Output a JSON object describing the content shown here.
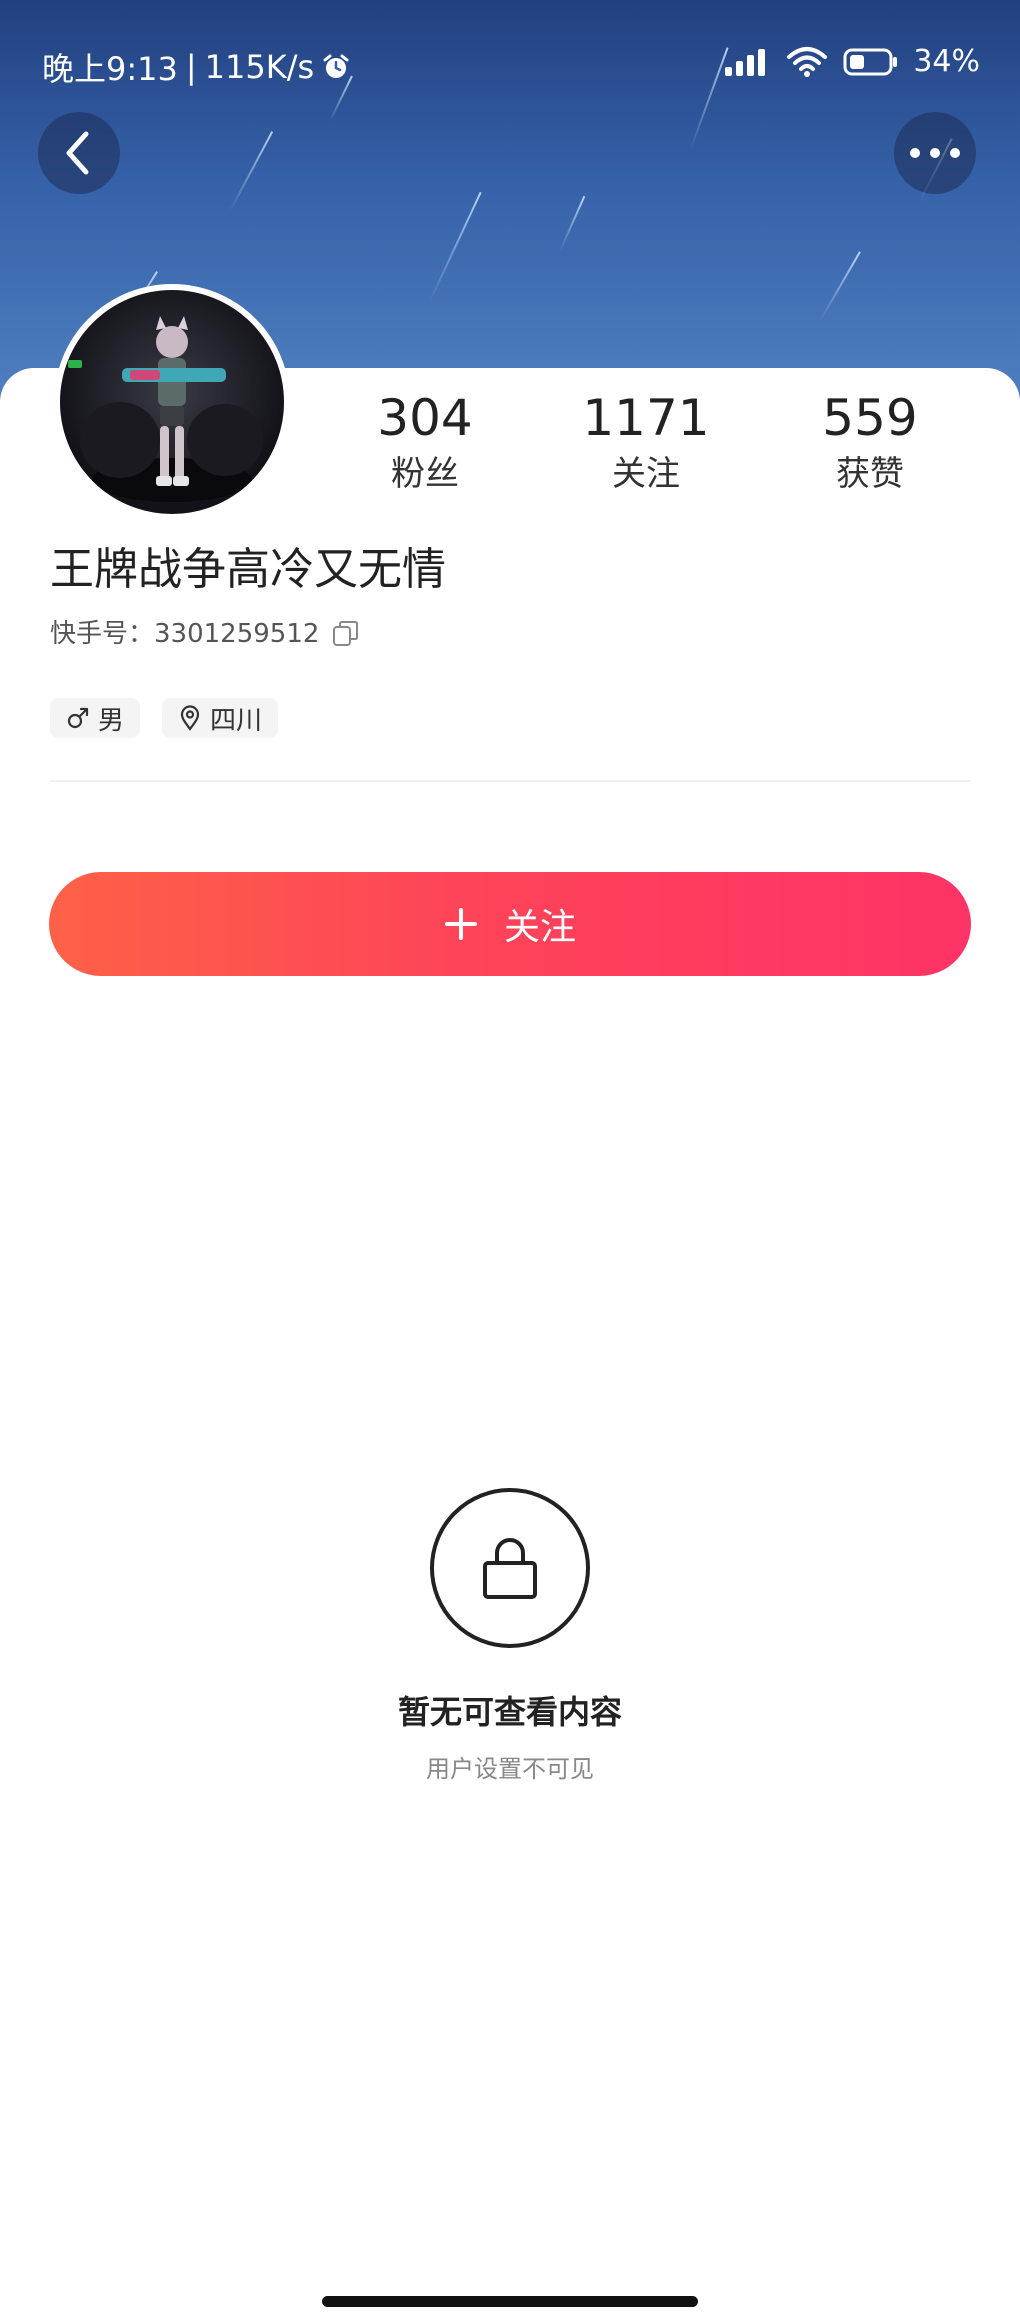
{
  "status_bar": {
    "time": "晚上9:13",
    "network_speed": "115K/s",
    "battery": "34%",
    "alarm_icon": "alarm-clock-icon",
    "signal_icon": "cellular-signal-icon",
    "wifi_icon": "wifi-icon",
    "battery_icon": "battery-icon"
  },
  "header": {
    "back_icon": "chevron-left-icon",
    "more_icon": "more-dots-icon"
  },
  "profile": {
    "avatar": "game-character-avatar",
    "stats": [
      {
        "value": "304",
        "label": "粉丝"
      },
      {
        "value": "1171",
        "label": "关注"
      },
      {
        "value": "559",
        "label": "获赞"
      }
    ],
    "username": "王牌战争高冷又无情",
    "user_id_label": "快手号：",
    "user_id_value": "3301259512",
    "copy_icon": "copy-icon",
    "tags": [
      {
        "icon": "male-gender-icon",
        "text": "男"
      },
      {
        "icon": "location-pin-icon",
        "text": "四川"
      }
    ]
  },
  "follow_button": {
    "icon": "plus-icon",
    "label": "关注"
  },
  "empty_state": {
    "icon": "lock-icon",
    "title": "暂无可查看内容",
    "subtitle": "用户设置不可见"
  },
  "colors": {
    "accent_gradient_start": "#fe6147",
    "accent_gradient_end": "#fe3366",
    "banner_dark": "#22407f",
    "banner_light": "#4f7fc0"
  }
}
